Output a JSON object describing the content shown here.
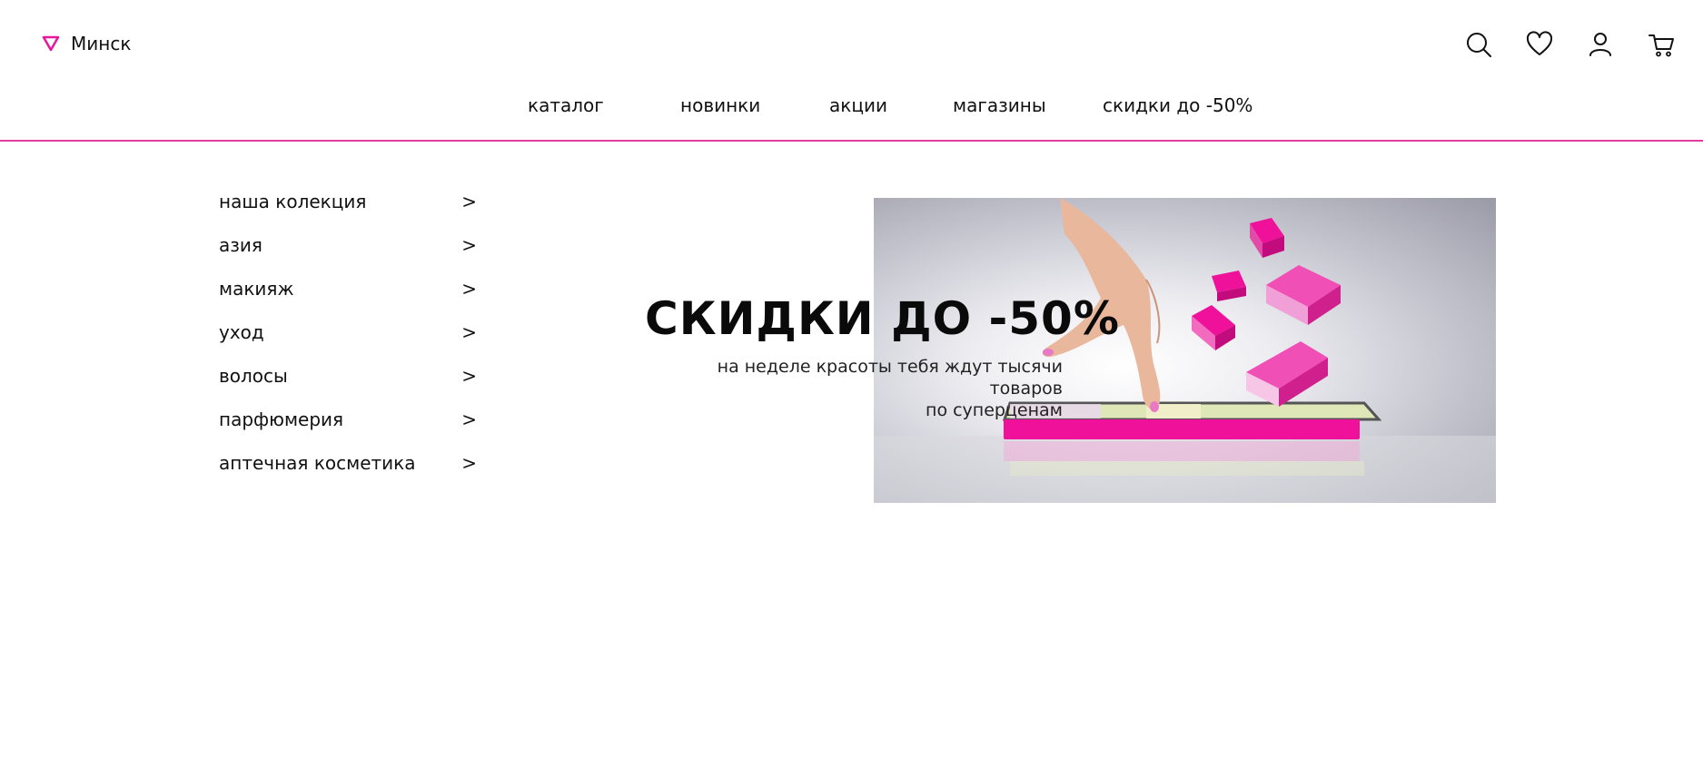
{
  "header": {
    "city": "Минск",
    "icons": [
      "search-icon",
      "heart-icon",
      "user-icon",
      "cart-icon"
    ]
  },
  "nav": {
    "items": [
      "каталог",
      "новинки",
      "акции",
      "магазины",
      "скидки до -50%"
    ]
  },
  "sidebar": {
    "items": [
      {
        "label": "наша колекция",
        "arrow": ">"
      },
      {
        "label": "азия",
        "arrow": ">"
      },
      {
        "label": "макияж",
        "arrow": ">"
      },
      {
        "label": "уход",
        "arrow": ">"
      },
      {
        "label": "волосы",
        "arrow": ">"
      },
      {
        "label": "парфюмерия",
        "arrow": ">"
      },
      {
        "label": "аптечная косметика",
        "arrow": ">"
      }
    ]
  },
  "promo": {
    "title": "СКИДКИ ДО -50%",
    "subtitle_line1": "на неделе красоты тебя ждут тысячи товаров",
    "subtitle_line2": "по суперценам"
  },
  "colors": {
    "accent": "#e23ba2",
    "magenta": "#f0119a"
  }
}
